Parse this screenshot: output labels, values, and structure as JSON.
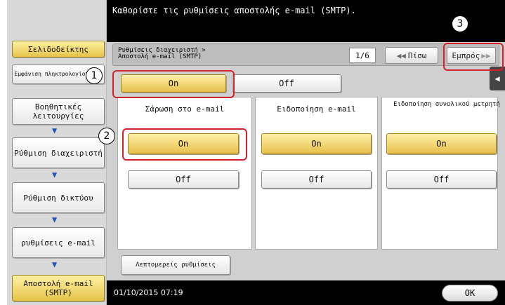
{
  "header": {
    "message": "Καθορίστε τις ρυθμίσεις αποστολής e-mail (SMTP)."
  },
  "sidebar": {
    "bookmark": "Σελιδοδείκτης",
    "numpad": "Εμφάνιση πληκτρολογίου αφή",
    "items": [
      {
        "label": "Βοηθητικές λειτουργίες"
      },
      {
        "label": "Ρύθμιση διαχειριστή"
      },
      {
        "label": "Ρύθμιση δικτύου"
      },
      {
        "label": "ρυθμίσεις e-mail"
      },
      {
        "label": "Αποστολή e-mail (SMTP)"
      }
    ]
  },
  "nav": {
    "breadcrumb_line1": "Ρυθμίσεις διαχειριστή >",
    "breadcrumb_line2": "Αποστολή e-mail (SMTP)",
    "page": "1/6",
    "back": "Πίσω",
    "forward": "Εμπρός"
  },
  "toggle": {
    "on": "On",
    "off": "Off"
  },
  "panels": [
    {
      "title": "Σάρωση στο e-mail",
      "on": "On",
      "off": "Off"
    },
    {
      "title": "Ειδοποίηση e-mail",
      "on": "On",
      "off": "Off"
    },
    {
      "title": "Ειδοποίηση συνολικού μετρητή",
      "on": "On",
      "off": "Off"
    }
  ],
  "detail_button": "Λεπτομερείς ρυθμίσεις",
  "footer": {
    "datetime": "01/10/2015  07:19",
    "ok": "OK"
  },
  "callouts": [
    "1",
    "2",
    "3"
  ],
  "colors": {
    "selected": "#e7c04a",
    "highlight": "#d3222a"
  }
}
